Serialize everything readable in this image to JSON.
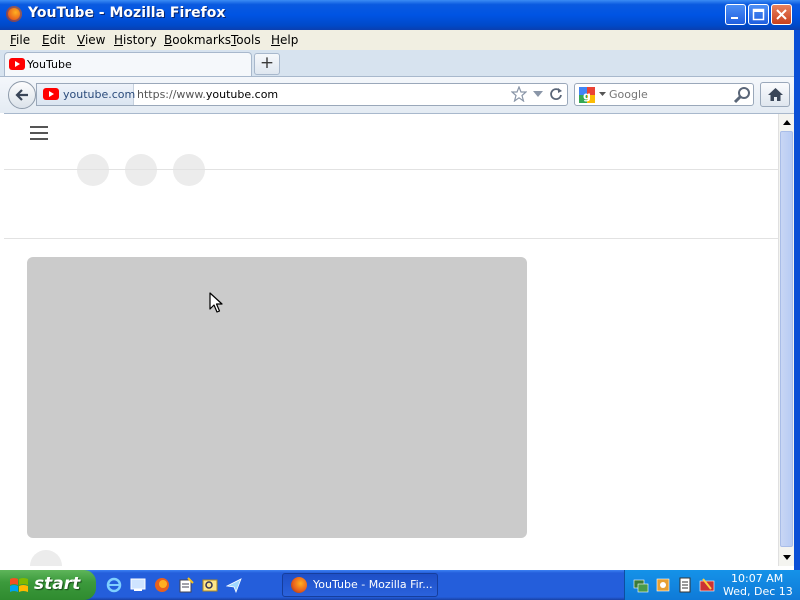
{
  "window": {
    "title": "YouTube - Mozilla Firefox",
    "buttons": [
      "minimize-icon",
      "maximize-icon",
      "close-icon"
    ]
  },
  "menubar": {
    "items": [
      {
        "accel": "F",
        "rest": "ile"
      },
      {
        "accel": "E",
        "rest": "dit"
      },
      {
        "accel": "V",
        "rest": "iew"
      },
      {
        "accel": "H",
        "rest": "istory"
      },
      {
        "accel": "B",
        "rest": "ookmarks"
      },
      {
        "accel": "T",
        "rest": "ools"
      },
      {
        "accel": "H",
        "rest": "elp"
      }
    ]
  },
  "tabs": {
    "items": [
      {
        "label": "YouTube",
        "icon": "youtube-icon"
      }
    ],
    "new_tab_label": "+"
  },
  "navbar": {
    "identity_label": "youtube.com",
    "url_prefix": "https://www.",
    "url_host": "youtube.com",
    "search_placeholder": "Google"
  },
  "taskbar": {
    "start_label": "start",
    "active_item": "YouTube - Mozilla Fir...",
    "clock_time": "10:07 AM",
    "clock_date": "Wed, Dec 13"
  },
  "colors": {
    "titlebar": "#0054e3",
    "menubar": "#f1efe2",
    "skeleton": "#cbcbcb",
    "youtube_red": "#ff0000"
  }
}
